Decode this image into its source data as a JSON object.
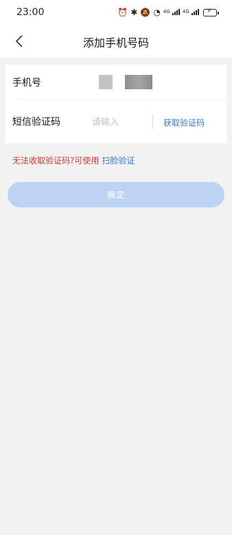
{
  "status_bar": {
    "time": "23:00",
    "icons": [
      "alarm-icon",
      "bluetooth-icon",
      "mute-icon",
      "wifi-icon",
      "signal-icon",
      "signal-icon",
      "battery-charging-icon"
    ],
    "net1": "4G",
    "net2": "4G"
  },
  "nav": {
    "title": "添加手机号码"
  },
  "form": {
    "phone_label": "手机号",
    "sms_label": "短信验证码",
    "code_placeholder": "请输入",
    "get_code_label": "获取验证码"
  },
  "fallback": {
    "text": "无法收取验证码?可使用",
    "link_label": "扫脸验证"
  },
  "confirm_label": "确定",
  "colors": {
    "link": "#3a78c8",
    "warning": "#d03a3a",
    "button_disabled": "#bcd3f1",
    "background": "#f2f2f2"
  }
}
